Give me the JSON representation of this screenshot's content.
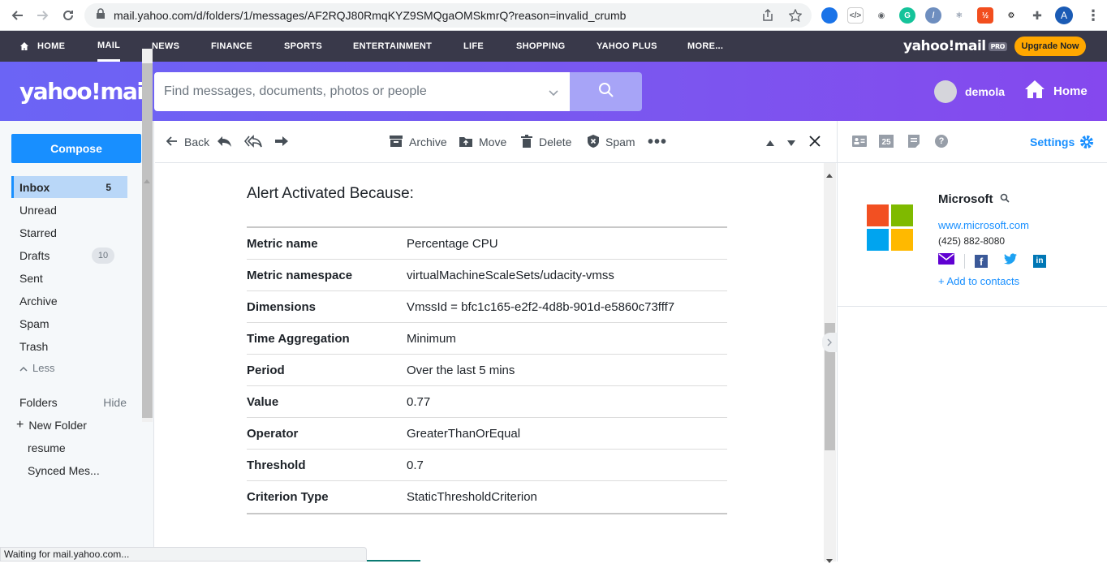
{
  "browser": {
    "url": "mail.yahoo.com/d/folders/1/messages/AF2RQJ80RmqKYZ9SMQgaOMSkmrQ?reason=invalid_crumb",
    "profile_initial": "A",
    "status_text": "Waiting for mail.yahoo.com..."
  },
  "topnav": {
    "items": [
      "HOME",
      "MAIL",
      "NEWS",
      "FINANCE",
      "SPORTS",
      "ENTERTAINMENT",
      "LIFE",
      "SHOPPING",
      "YAHOO PLUS",
      "MORE..."
    ],
    "brand": "yahoo!mail",
    "brand_badge": "PRO",
    "upgrade_label": "Upgrade Now"
  },
  "header": {
    "logo": "yahoo!mail",
    "search_placeholder": "Find messages, documents, photos or people",
    "username": "demola",
    "home_label": "Home"
  },
  "sidebar": {
    "compose_label": "Compose",
    "folders": [
      {
        "label": "Inbox",
        "count": "5"
      },
      {
        "label": "Unread",
        "count": ""
      },
      {
        "label": "Starred",
        "count": ""
      },
      {
        "label": "Drafts",
        "count": "10"
      },
      {
        "label": "Sent",
        "count": ""
      },
      {
        "label": "Archive",
        "count": ""
      },
      {
        "label": "Spam",
        "count": ""
      },
      {
        "label": "Trash",
        "count": ""
      }
    ],
    "less_label": "Less",
    "folders_label": "Folders",
    "hide_label": "Hide",
    "new_folder_label": "New Folder",
    "custom_folders": [
      "resume",
      "Synced Mes..."
    ]
  },
  "toolbar": {
    "back_label": "Back",
    "archive_label": "Archive",
    "move_label": "Move",
    "delete_label": "Delete",
    "spam_label": "Spam"
  },
  "message": {
    "heading": "Alert Activated Because:",
    "rows": [
      {
        "key": "Metric name",
        "value": "Percentage CPU"
      },
      {
        "key": "Metric namespace",
        "value": "virtualMachineScaleSets/udacity-vmss"
      },
      {
        "key": "Dimensions",
        "value": "VmssId = bfc1c165-e2f2-4d8b-901d-e5860c73fff7"
      },
      {
        "key": "Time Aggregation",
        "value": "Minimum"
      },
      {
        "key": "Period",
        "value": "Over the last 5 mins"
      },
      {
        "key": "Value",
        "value": "0.77"
      },
      {
        "key": "Operator",
        "value": "GreaterThanOrEqual"
      },
      {
        "key": "Threshold",
        "value": "0.7"
      },
      {
        "key": "Criterion Type",
        "value": "StaticThresholdCriterion"
      }
    ]
  },
  "right_panel": {
    "settings_label": "Settings",
    "calendar_day": "25",
    "contact": {
      "name": "Microsoft",
      "website": "www.microsoft.com",
      "phone": "(425) 882-8080",
      "add_label": "+ Add to contacts"
    }
  },
  "colors": {
    "accent": "#188fff",
    "nav_bg": "#39394a",
    "header_gradient_start": "#6b64f5",
    "upgrade": "#ffa700"
  }
}
